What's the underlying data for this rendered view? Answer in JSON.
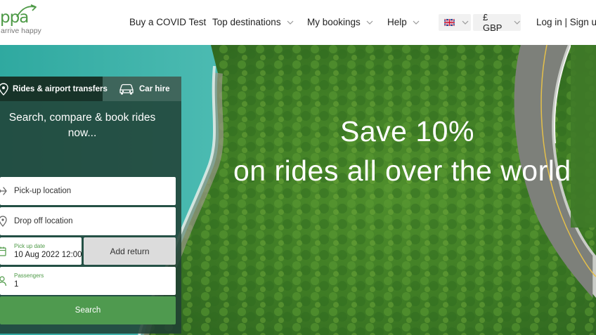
{
  "brand": {
    "name": "ppa",
    "tagline": "arrive happy",
    "accent_color": "#4e9a47"
  },
  "nav": {
    "covid_test": "Buy a COVID Test",
    "top_destinations": "Top destinations",
    "my_bookings": "My bookings",
    "help": "Help",
    "language_flag": "uk-flag-icon",
    "currency": "£ GBP",
    "login": "Log in | Sign up"
  },
  "hero": {
    "promo_line1": "Save 10%",
    "promo_line2": "on rides all over the world"
  },
  "widget": {
    "tabs": [
      {
        "label": "Rides & airport transfers",
        "icon": "location-pin-icon",
        "active": true
      },
      {
        "label": "Car hire",
        "icon": "car-icon",
        "active": false
      }
    ],
    "title": "Search, compare & book rides now...",
    "pickup_placeholder": "Pick-up location",
    "dropoff_placeholder": "Drop off location",
    "pickup_date_label": "Pick up date",
    "pickup_date_value": "10 Aug 2022 12:00",
    "add_return_label": "Add return",
    "passengers_label": "Passengers",
    "passengers_value": "1",
    "search_label": "Search",
    "search_color": "#4f9a4f"
  }
}
